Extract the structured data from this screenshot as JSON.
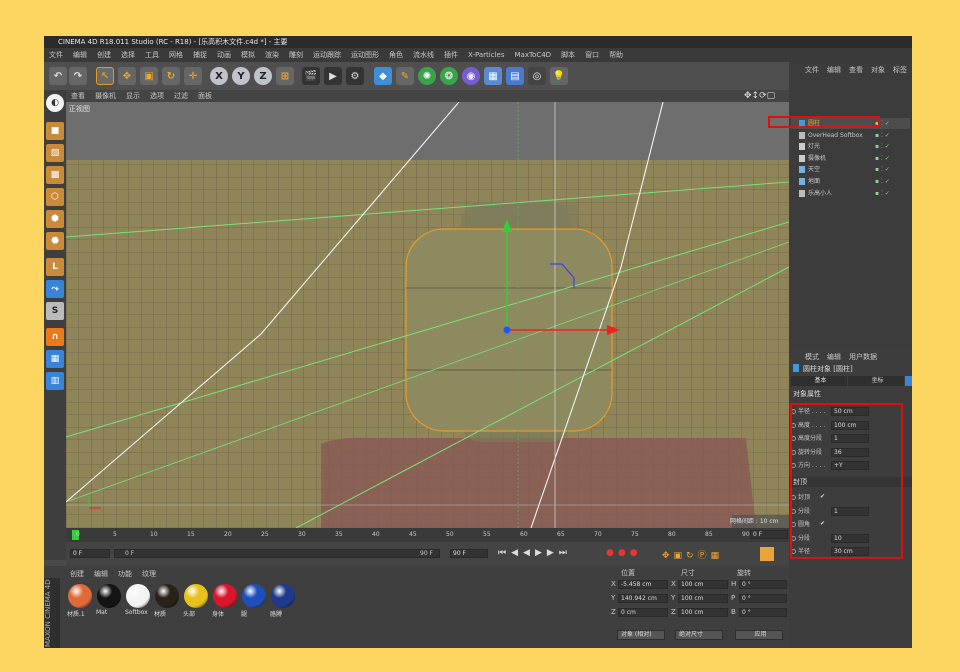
{
  "window": {
    "title": "CINEMA 4D R18.011 Studio (RC - R18) - [乐高积木文件.c4d *] - 主要"
  },
  "menu": [
    "文件",
    "编辑",
    "创建",
    "选择",
    "工具",
    "网格",
    "捕捉",
    "动画",
    "模拟",
    "渲染",
    "雕刻",
    "运动跟踪",
    "运动图形",
    "角色",
    "流水线",
    "插件",
    "X-Particles",
    "MaxToC4D",
    "脚本",
    "窗口",
    "帮助"
  ],
  "toolbar": {
    "axis_x": "X",
    "axis_y": "Y",
    "axis_z": "Z"
  },
  "viewport": {
    "menu": [
      "查看",
      "摄像机",
      "显示",
      "选项",
      "过滤",
      "面板"
    ],
    "label": "正视图",
    "grid_info": "网格间距 : 10 cm"
  },
  "timeline": {
    "ticks": [
      "0",
      "5",
      "10",
      "15",
      "20",
      "25",
      "30",
      "35",
      "40",
      "45",
      "50",
      "55",
      "60",
      "65",
      "70",
      "75",
      "80",
      "85",
      "90"
    ],
    "end_frame": "0 F"
  },
  "playback": {
    "start": "0 F",
    "range_start": "0 F",
    "range_end": "90 F",
    "end": "90 F"
  },
  "materials": {
    "menu": [
      "创建",
      "编辑",
      "功能",
      "纹理"
    ],
    "items": [
      {
        "name": "材质.1",
        "color": "#e06a3a"
      },
      {
        "name": "Mat",
        "color": "#141414"
      },
      {
        "name": "Softbox",
        "color": "#f4f4f4"
      },
      {
        "name": "材质",
        "color": "#2a2218"
      },
      {
        "name": "头部",
        "color": "#e7c21f"
      },
      {
        "name": "身体",
        "color": "#d8172a"
      },
      {
        "name": "腿",
        "color": "#1f4fb8"
      },
      {
        "name": "胳膊",
        "color": "#1e3a8c"
      }
    ],
    "brand": "MAXON CINEMA 4D"
  },
  "coords": {
    "headers": {
      "pos": "位置",
      "size": "尺寸",
      "rot": "旋转"
    },
    "rows": [
      {
        "axis": "X",
        "pos": "-5.458 cm",
        "saxis": "X",
        "size": "100 cm",
        "raxis": "H",
        "rot": "0 °"
      },
      {
        "axis": "Y",
        "pos": "140.942 cm",
        "saxis": "Y",
        "size": "100 cm",
        "raxis": "P",
        "rot": "0 °"
      },
      {
        "axis": "Z",
        "pos": "0 cm",
        "saxis": "Z",
        "size": "100 cm",
        "raxis": "B",
        "rot": "0 °"
      }
    ],
    "mode": "对象 (相对)",
    "size_mode": "绝对尺寸",
    "apply": "应用"
  },
  "objects": {
    "menu": [
      "文件",
      "编辑",
      "查看",
      "对象",
      "标签"
    ],
    "items": [
      {
        "name": "圆柱",
        "icon": "cylinder-icon"
      },
      {
        "name": "OverHead Softbox",
        "icon": "null-icon"
      },
      {
        "name": "灯光",
        "icon": "light-icon"
      },
      {
        "name": "摄像机",
        "icon": "camera-icon"
      },
      {
        "name": "天空",
        "icon": "sky-icon"
      },
      {
        "name": "地面",
        "icon": "floor-icon"
      },
      {
        "name": "乐高小人",
        "icon": "null-icon"
      }
    ]
  },
  "attributes": {
    "menu": [
      "模式",
      "编辑",
      "用户数据"
    ],
    "object_title": "圆柱对象 [圆柱]",
    "tabs": [
      "基本",
      "坐标"
    ],
    "section": "对象属性",
    "props": [
      {
        "label": "半径 . . . .",
        "value": "50 cm"
      },
      {
        "label": "高度 . . . .",
        "value": "100 cm"
      },
      {
        "label": "高度分段",
        "value": "1"
      },
      {
        "label": "旋转分段",
        "value": "36"
      },
      {
        "label": "方向 . . . .",
        "value": "+Y"
      }
    ],
    "caps_section": "封顶",
    "caps": [
      {
        "label": "封顶",
        "value": "✔"
      },
      {
        "label": "分段",
        "value": "1"
      },
      {
        "label": "圆角",
        "value": "✔"
      },
      {
        "label": "分段",
        "value": "10"
      },
      {
        "label": "半径",
        "value": "30 cm"
      }
    ]
  }
}
